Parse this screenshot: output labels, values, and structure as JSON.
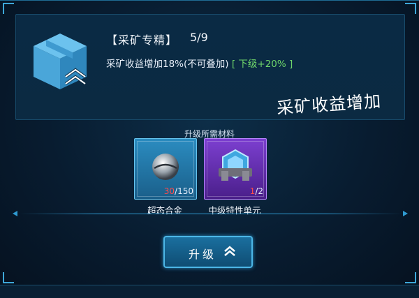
{
  "skill": {
    "title": "【采矿专精】",
    "level": "5/9",
    "desc_main": "采矿收益增加18%(不可叠加)",
    "desc_next": "[ 下级+20% ]",
    "icon": "mining-crate-icon"
  },
  "overlay_caption": "采矿收益增加",
  "materials": {
    "title": "升级所需材料",
    "items": [
      {
        "name": "超态合金",
        "have": "30",
        "need": "/150",
        "icon": "alloy-sphere-icon",
        "rarity_color": "#2b8cc0"
      },
      {
        "name": "中级特性单元",
        "have": "1",
        "need": "/2",
        "icon": "trait-unit-icon",
        "rarity_color": "#7c3fd0"
      }
    ]
  },
  "upgrade_button": {
    "label": "升级",
    "icon": "double-chevron-up-icon"
  }
}
